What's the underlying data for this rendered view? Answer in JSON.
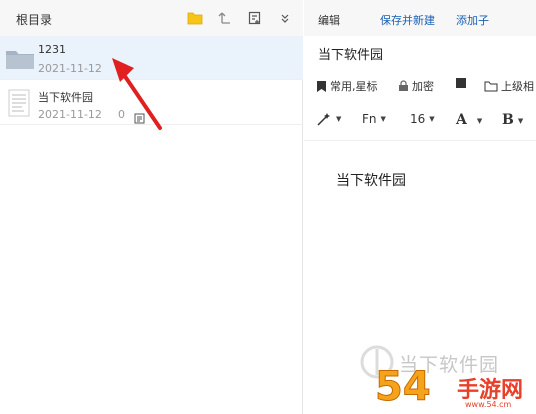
{
  "left_panel": {
    "root_label": "根目录",
    "toolbar_icons": [
      "folder-icon",
      "up-arrow-icon",
      "new-note-icon",
      "expand-more-icon"
    ],
    "items": [
      {
        "title": "1231",
        "date": "2021-11-12",
        "count": "",
        "icon": "folder-icon",
        "selected": true
      },
      {
        "title": "当下软件园",
        "date": "2021-11-12",
        "count": "0",
        "icon": "document-icon",
        "selected": false
      }
    ]
  },
  "right_panel": {
    "top_links": {
      "edit": "编辑",
      "save_new": "保存并新建",
      "add_sub": "添加子"
    },
    "doc_title": "当下软件园",
    "toolbar1": {
      "favorite": "常用,星标",
      "encrypt": "加密",
      "superior": "上级相"
    },
    "toolbar2": {
      "font": "Fn",
      "size": "16",
      "font_color": "A",
      "bold": "B"
    },
    "body_text": "当下软件园"
  },
  "watermark": {
    "site_name": "当下软件园",
    "logo_number": "54",
    "logo_brand": "手游网",
    "logo_url": "www.54.cm"
  },
  "colors": {
    "accent_blue": "#1a5fb4",
    "folder_yellow": "#f5c518",
    "arrow_red": "#e02020",
    "selected_bg": "#eaf2fb"
  }
}
